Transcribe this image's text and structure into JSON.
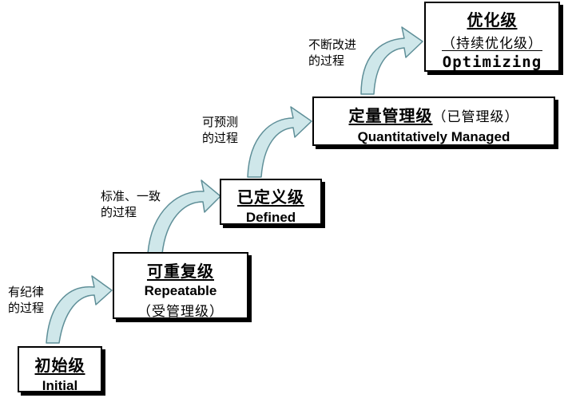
{
  "levels": {
    "initial": {
      "cn": "初始级",
      "en": "Initial"
    },
    "repeatable": {
      "cn": "可重复级",
      "en": "Repeatable",
      "sub": "（受管理级）"
    },
    "defined": {
      "cn": "已定义级",
      "en": "Defined"
    },
    "managed": {
      "cn": "定量管理级",
      "sub": "（已管理级）",
      "en": "Quantitatively Managed"
    },
    "optimizing": {
      "cn": "优化级",
      "sub": "（持续优化级）",
      "en": "Optimizing"
    }
  },
  "transitions": {
    "to_repeatable": [
      "有纪律",
      "的过程"
    ],
    "to_defined": [
      "标准、一致",
      "的过程"
    ],
    "to_managed": [
      "可预测",
      "的过程"
    ],
    "to_optimizing": [
      "不断改进",
      "的过程"
    ]
  },
  "colors": {
    "arrow_fill": "#cfe7ea",
    "arrow_stroke": "#5f8f98",
    "box_border": "#000000"
  }
}
